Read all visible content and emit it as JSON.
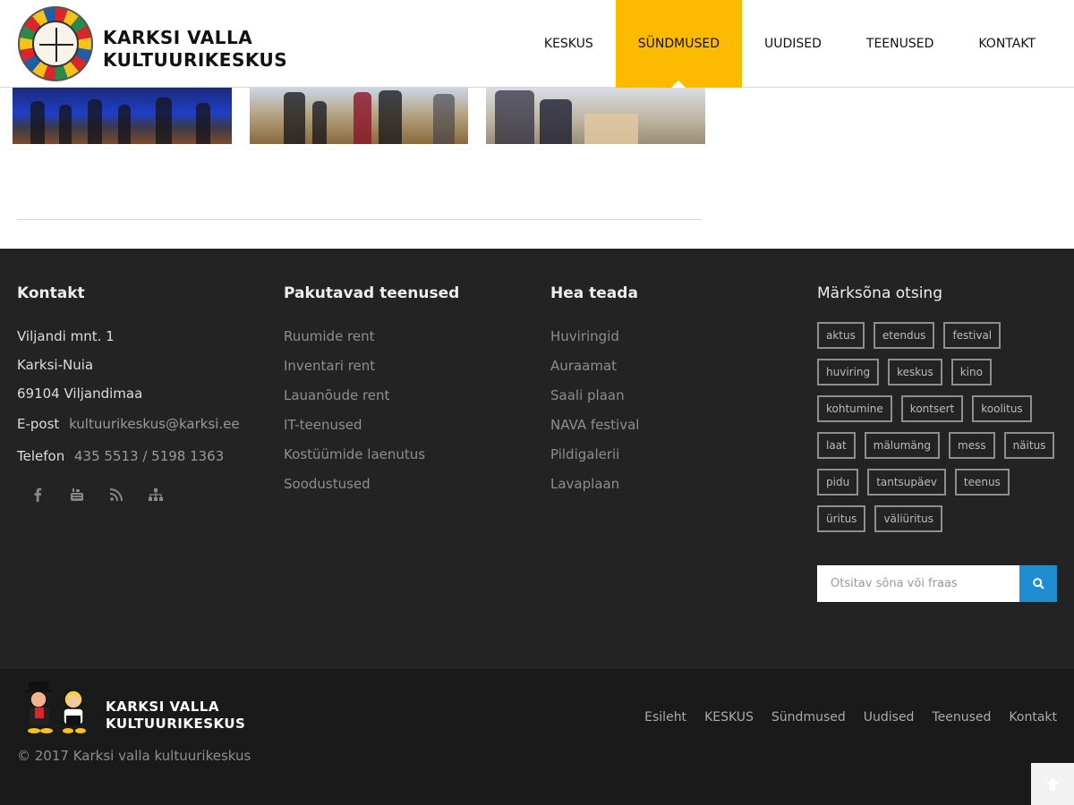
{
  "header": {
    "logo_line1": "KARKSI VALLA",
    "logo_line2": "KULTUURIKESKUS",
    "nav": [
      {
        "label": "KESKUS"
      },
      {
        "label": "SÜNDMUSED"
      },
      {
        "label": "UUDISED"
      },
      {
        "label": "TEENUSED"
      },
      {
        "label": "KONTAKT"
      }
    ],
    "active_nav": "SÜNDMUSED",
    "accent_color": "#fdbb00"
  },
  "footer": {
    "contact": {
      "title": "Kontakt",
      "address1": "Viljandi mnt. 1",
      "address2": "Karksi-Nuia",
      "address3": "69104 Viljandimaa",
      "email_label": "E-post",
      "email": "kultuurikeskus@karksi.ee",
      "phone_label": "Telefon",
      "phone": "435 5513 / 5198 1363",
      "social_icons": [
        "facebook-icon",
        "youtube-icon",
        "rss-icon",
        "sitemap-icon"
      ]
    },
    "services": {
      "title": "Pakutavad teenused",
      "links": [
        "Ruumide rent",
        "Inventari rent",
        "Lauanõude rent",
        "IT-teenused",
        "Kostüümide laenutus",
        "Soodustused"
      ]
    },
    "good_to_know": {
      "title": "Hea teada",
      "links": [
        "Huviringid",
        "Auraamat",
        "Saali plaan",
        "NAVA festival",
        "Pildigalerii",
        "Lavaplaan"
      ]
    },
    "tag_search": {
      "title": "Märksõna otsing",
      "tags": [
        "aktus",
        "etendus",
        "festival",
        "huviring",
        "keskus",
        "kino",
        "kohtumine",
        "kontsert",
        "koolitus",
        "laat",
        "mälumäng",
        "mess",
        "näitus",
        "pidu",
        "tantsupäev",
        "teenus",
        "üritus",
        "väliüritus"
      ],
      "search_placeholder": "Otsitav sõna või fraas",
      "search_button_color": "#1e8ed1"
    }
  },
  "bottom": {
    "logo_line1": "KARKSI VALLA",
    "logo_line2": "KULTUURIKESKUS",
    "copyright": "© 2017 Karksi valla kultuurikeskus",
    "nav": [
      "Esileht",
      "KESKUS",
      "Sündmused",
      "Uudised",
      "Teenused",
      "Kontakt"
    ]
  }
}
